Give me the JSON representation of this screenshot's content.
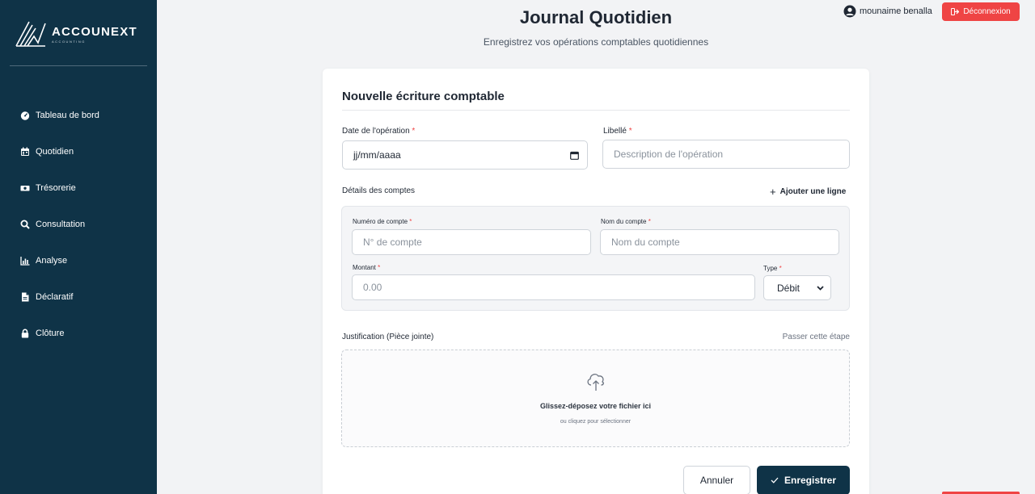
{
  "brand": {
    "name": "ACCOUNEXT",
    "sub": "ACCOUNTING"
  },
  "sidebar": {
    "items": [
      {
        "label": "Tableau de bord",
        "icon": "gauge-icon"
      },
      {
        "label": "Quotidien",
        "icon": "calendar-icon"
      },
      {
        "label": "Trésorerie",
        "icon": "money-bill-icon"
      },
      {
        "label": "Consultation",
        "icon": "search-icon"
      },
      {
        "label": "Analyse",
        "icon": "bar-chart-icon"
      },
      {
        "label": "Déclaratif",
        "icon": "file-icon"
      },
      {
        "label": "Clôture",
        "icon": "lock-icon"
      }
    ]
  },
  "header": {
    "title": "Journal Quotidien",
    "subtitle": "Enregistrez vos opérations comptables quotidiennes",
    "user": "mounaime benalla",
    "logout_label": "Déconnexion"
  },
  "form": {
    "title": "Nouvelle écriture comptable",
    "date_label": "Date de l'opération",
    "date_value": "jj/mm/aaaa",
    "libelle_label": "Libellé",
    "libelle_placeholder": "Description de l'opération",
    "details_label": "Détails des comptes",
    "add_line_label": "Ajouter une ligne",
    "account_number_label": "Numéro de compte",
    "account_number_placeholder": "N° de compte",
    "account_name_label": "Nom du compte",
    "account_name_placeholder": "Nom du compte",
    "amount_label": "Montant",
    "amount_placeholder": "0.00",
    "type_label": "Type",
    "type_value": "Débit",
    "justification_label": "Justification (Pièce jointe)",
    "skip_label": "Passer cette étape",
    "drop_title": "Glissez-déposez votre fichier ici",
    "drop_sub": "ou cliquez pour sélectionner",
    "cancel_label": "Annuler",
    "save_label": "Enregistrer",
    "required_mark": "*"
  },
  "colors": {
    "sidebar": "#0f3347",
    "danger": "#ef4444",
    "primary": "#0f3347"
  }
}
